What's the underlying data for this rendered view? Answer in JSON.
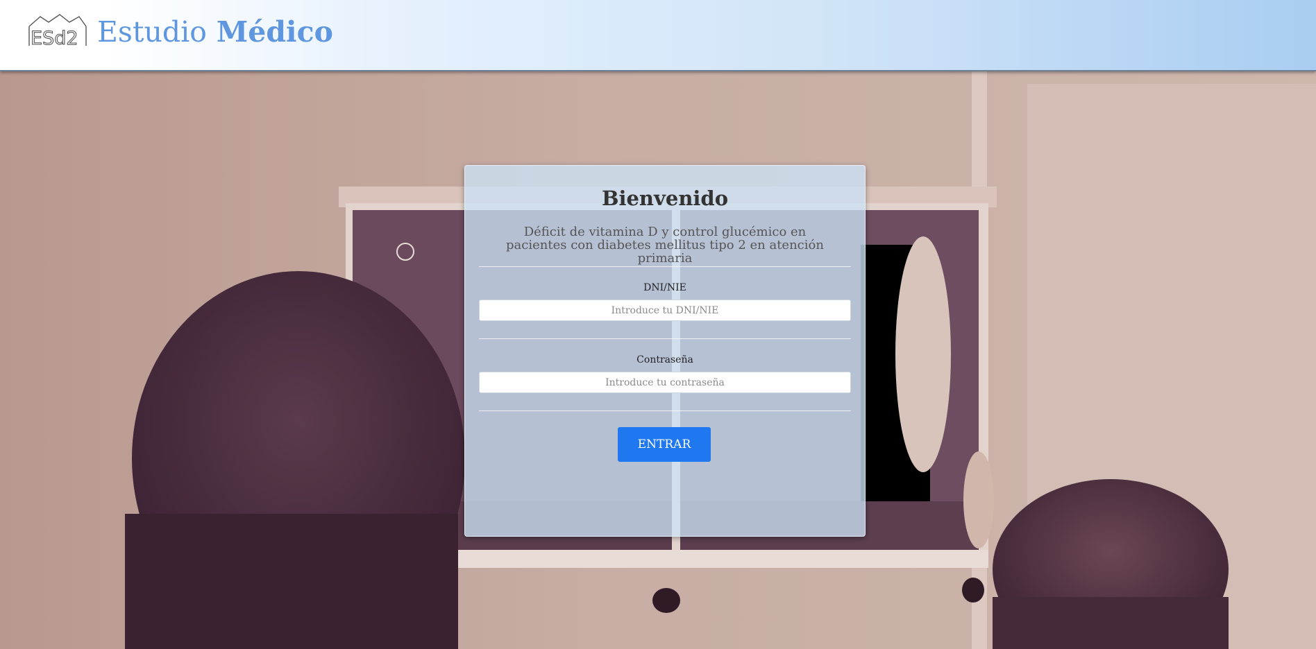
{
  "header": {
    "brand_word1": "Estudio",
    "brand_word2": "Médico",
    "logo_text": "ESd2"
  },
  "login": {
    "title": "Bienvenido",
    "subtitle": "Déficit de vitamina D y control glucémico en pacientes con diabetes mellitus tipo 2 en atención primaria",
    "dni_label": "DNI/NIE",
    "dni_placeholder": "Introduce tu DNI/NIE",
    "dni_value": "",
    "password_label": "Contraseña",
    "password_placeholder": "Introduce tu contraseña",
    "password_value": "",
    "submit_label": "ENTRAR"
  },
  "colors": {
    "brand": "#5e97df",
    "button": "#1f78ef",
    "header_gradient_end": "#a9cdf1"
  }
}
